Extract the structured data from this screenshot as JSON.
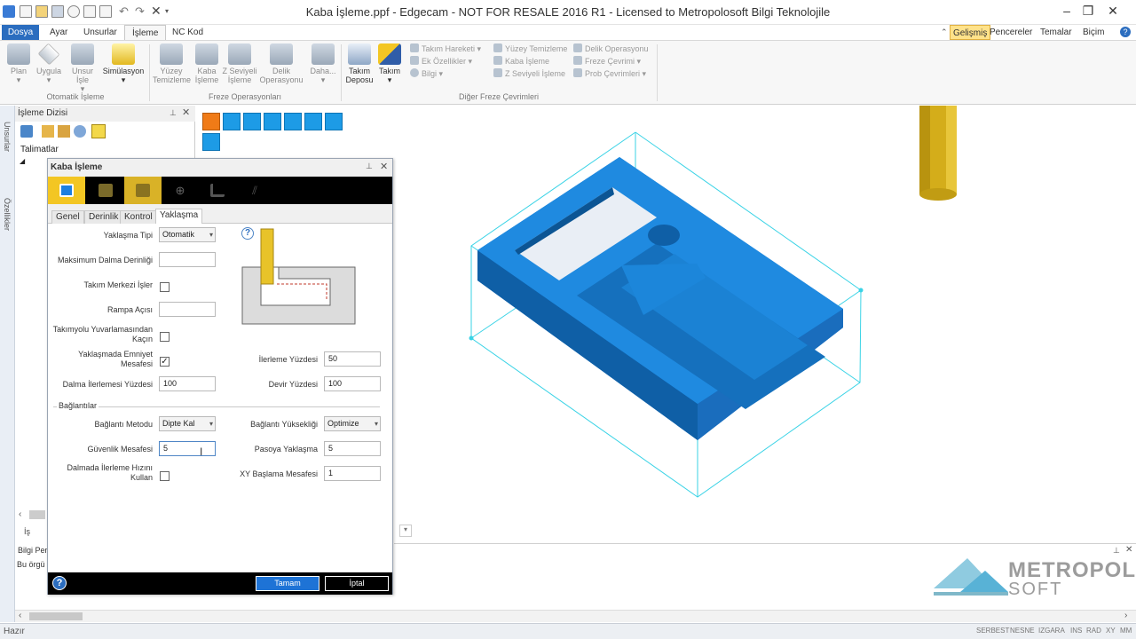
{
  "window": {
    "title": "Kaba İşleme.ppf - Edgecam - NOT FOR RESALE 2016 R1  - Licensed to Metropolosoft Bilgi Teknolojile"
  },
  "tabs": [
    "Dosya",
    "Ayar",
    "Unsurlar",
    "İşleme",
    "NC Kod"
  ],
  "right_tabs": {
    "gelismis": "Gelişmiş",
    "pencereler": "Pencereler",
    "temalar": "Temalar",
    "bicim": "Biçim"
  },
  "ribbon": {
    "buttons": [
      {
        "label": "Plan"
      },
      {
        "label": "Uygula"
      },
      {
        "label": "Unsur İşle"
      },
      {
        "label": "Simülasyon"
      },
      {
        "label": "Yüzey Temizleme"
      },
      {
        "label": "Kaba İşleme"
      },
      {
        "label": "Z Seviyeli İşleme"
      },
      {
        "label": "Delik Operasyonu"
      },
      {
        "label": "Daha..."
      },
      {
        "label": "Takım Deposu"
      },
      {
        "label": "Takım"
      }
    ],
    "small_col1": [
      "Takım Hareketi",
      "Ek Özellikler",
      "Bilgi"
    ],
    "small_col2": [
      "Yüzey Temizleme",
      "Kaba İşleme",
      "Z Seviyeli İşleme"
    ],
    "small_col3": [
      "Delik Operasyonu",
      "Freze Çevrimi",
      "Prob Çevrimleri"
    ],
    "groups": [
      "Otomatik İşleme",
      "Freze Operasyonları",
      "Diğer Freze Çevrimleri"
    ]
  },
  "side_strip": [
    "Unsurlar",
    "Özellikler"
  ],
  "left_panel": {
    "title": "İşleme Dizisi",
    "talimatlar": "Talimatlar",
    "bottom_tab": "İş",
    "bilgi_title": "Bilgi Per",
    "bilgi_text": "Bu örgü"
  },
  "dialog": {
    "title": "Kaba İşleme",
    "tabs": [
      "Genel",
      "Derinlik",
      "Kontrol",
      "Yaklaşma"
    ],
    "fields": {
      "yaklasma_tipi_label": "Yaklaşma Tipi",
      "yaklasma_tipi_value": "Otomatik",
      "max_dalma_label": "Maksimum Dalma Derinliği",
      "max_dalma_value": "",
      "takim_merkezi_label": "Takım Merkezi İşler",
      "takim_merkezi_checked": false,
      "rampa_label": "Rampa Açısı",
      "rampa_value": "",
      "takimyolu_label": "Takımyolu Yuvarlamasından Kaçın",
      "takimyolu_checked": false,
      "emniyet_label": "Yaklaşmada Emniyet Mesafesi",
      "emniyet_checked": true,
      "ilerleme_yuzdesi_label": "İlerleme Yüzdesi",
      "ilerleme_yuzdesi_value": "50",
      "dalma_ilerlemesi_label": "Dalma İlerlemesi Yüzdesi",
      "dalma_ilerlemesi_value": "100",
      "devir_yuzdesi_label": "Devir Yüzdesi",
      "devir_yuzdesi_value": "100",
      "baglantilar_label": "Bağlantılar",
      "baglanti_metodu_label": "Bağlantı Metodu",
      "baglanti_metodu_value": "Dipte Kal",
      "baglanti_yuksekligi_label": "Bağlantı Yüksekliği",
      "baglanti_yuksekligi_value": "Optimize",
      "guvenlik_label": "Güvenlik Mesafesi",
      "guvenlik_value": "5",
      "pasoya_label": "Pasoya Yaklaşma",
      "pasoya_value": "5",
      "dalmada_label": "Dalmada İlerleme Hızını Kullan",
      "dalmada_checked": false,
      "xy_label": "XY Başlama Mesafesi",
      "xy_value": "1"
    },
    "ok": "Tamam",
    "cancel": "İptal"
  },
  "status": {
    "left": "Hazır",
    "items": [
      "SERBEST",
      "NESNE",
      "IZGARA",
      "INS",
      "RAD",
      "XY",
      "MM"
    ]
  },
  "watermark": {
    "line1": "METROPOL",
    "line2": "SOFT"
  },
  "colors": {
    "accent": "#2b6dbf",
    "part": "#1a7fd4",
    "box": "#32d6e8",
    "tool": "#d8b21a"
  }
}
